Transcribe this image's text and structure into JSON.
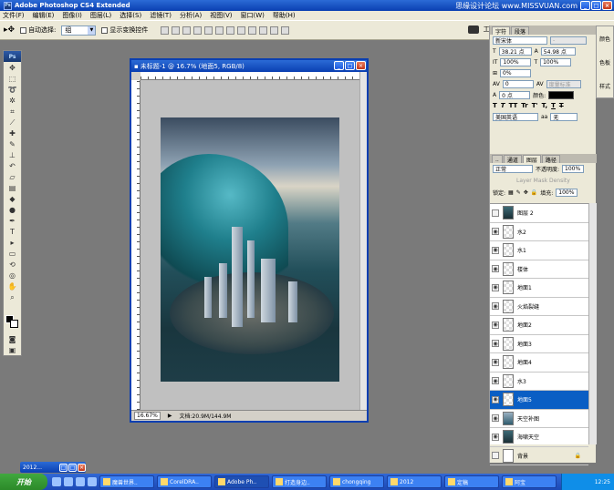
{
  "app": {
    "title": "Adobe Photoshop CS4 Extended",
    "watermark": "思缘设计论坛 www.MISSVUAN.com"
  },
  "menu": [
    "文件(F)",
    "编辑(E)",
    "图像(I)",
    "图层(L)",
    "选择(S)",
    "滤镜(T)",
    "分析(A)",
    "视图(V)",
    "窗口(W)",
    "帮助(H)"
  ],
  "options": {
    "auto_select_label": "自动选择:",
    "auto_select_value": "组",
    "show_transform_label": "显示变换控件",
    "workspace_label": "工作区"
  },
  "document": {
    "title": "未标题-1 @ 16.7% (地面5, RGB/8)",
    "zoom": "16.67%",
    "doc_size": "文档:20.9M/144.9M"
  },
  "character": {
    "tabs": [
      "字符",
      "段落"
    ],
    "font_family": "新宋体",
    "font_style": "-",
    "font_size": "38.21 点",
    "leading": "54.98 点",
    "vscale": "100%",
    "hscale": "100%",
    "baseline_shift_pct": "0%",
    "tracking": "0",
    "kerning_label": "度量标准",
    "baseline": "0 点",
    "color_label": "颜色:",
    "language": "美国英语",
    "antialias": "无",
    "style_buttons": [
      "T",
      "T",
      "TT",
      "Tr",
      "T'",
      "T,",
      "T",
      "T"
    ]
  },
  "side_strip": [
    "颜色",
    "色板",
    "样式"
  ],
  "layers_panel": {
    "tabs": [
      "图层",
      "通道",
      "路径"
    ],
    "blend_mode": "正常",
    "opacity_label": "不透明度:",
    "opacity": "100%",
    "layer_mask_density": "Layer Mask Density",
    "lock_label": "锁定:",
    "fill_label": "填充:",
    "fill": "100%",
    "layers": [
      {
        "name": "图层 2",
        "thumb": "img",
        "visible": false,
        "selected": false
      },
      {
        "name": "水2",
        "thumb": "trans",
        "visible": true,
        "selected": false
      },
      {
        "name": "水1",
        "thumb": "trans",
        "visible": true,
        "selected": false
      },
      {
        "name": "楼体",
        "thumb": "trans",
        "visible": true,
        "selected": false
      },
      {
        "name": "地面1",
        "thumb": "trans",
        "visible": true,
        "selected": false
      },
      {
        "name": "火焰裂缝",
        "thumb": "trans",
        "visible": true,
        "selected": false
      },
      {
        "name": "地面2",
        "thumb": "trans",
        "visible": true,
        "selected": false
      },
      {
        "name": "地面3",
        "thumb": "trans",
        "visible": true,
        "selected": false
      },
      {
        "name": "地面4",
        "thumb": "trans",
        "visible": true,
        "selected": false
      },
      {
        "name": "水3",
        "thumb": "trans",
        "visible": true,
        "selected": false
      },
      {
        "name": "地面5",
        "thumb": "trans",
        "visible": true,
        "selected": true
      },
      {
        "name": "天空补图",
        "thumb": "sky",
        "visible": true,
        "selected": false
      },
      {
        "name": "海啸天空",
        "thumb": "img",
        "visible": true,
        "selected": false
      },
      {
        "name": "背景",
        "thumb": "white",
        "visible": false,
        "selected": false
      }
    ]
  },
  "minimized_doc": {
    "title": "2012..."
  },
  "taskbar": {
    "start": "开始",
    "tasks": [
      "魔兽世界..",
      "CorelDRA..",
      "Adobe Ph..",
      "打造身边..",
      "chongqing",
      "2012",
      "定稿",
      "阿宝"
    ],
    "active_task": 2,
    "clock": "12:25"
  }
}
